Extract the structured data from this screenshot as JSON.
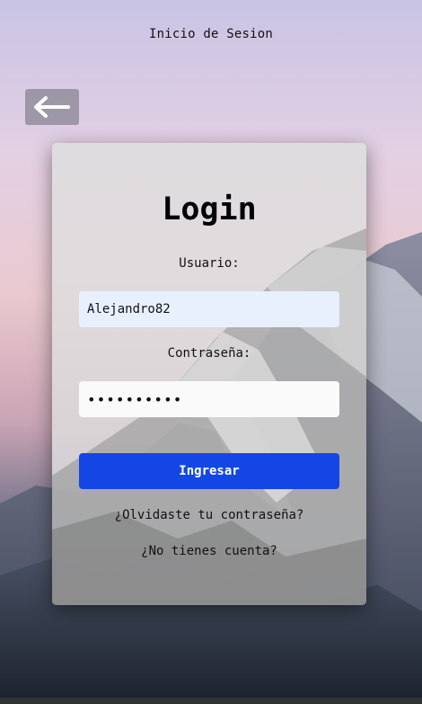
{
  "header": {
    "title": "Inicio de Sesion",
    "back_icon": "arrow-left-icon"
  },
  "login": {
    "heading": "Login",
    "username_label": "Usuario:",
    "username_value": "Alejandro82",
    "password_label": "Contraseña:",
    "password_value": "••••••••••",
    "submit_label": "Ingresar",
    "forgot_link": "¿Olvidaste tu contraseña?",
    "register_link": "¿No tienes cuenta?"
  },
  "colors": {
    "submit_button": "#1446e6",
    "username_field": "#e8f0fe",
    "password_field": "#fafafa"
  }
}
